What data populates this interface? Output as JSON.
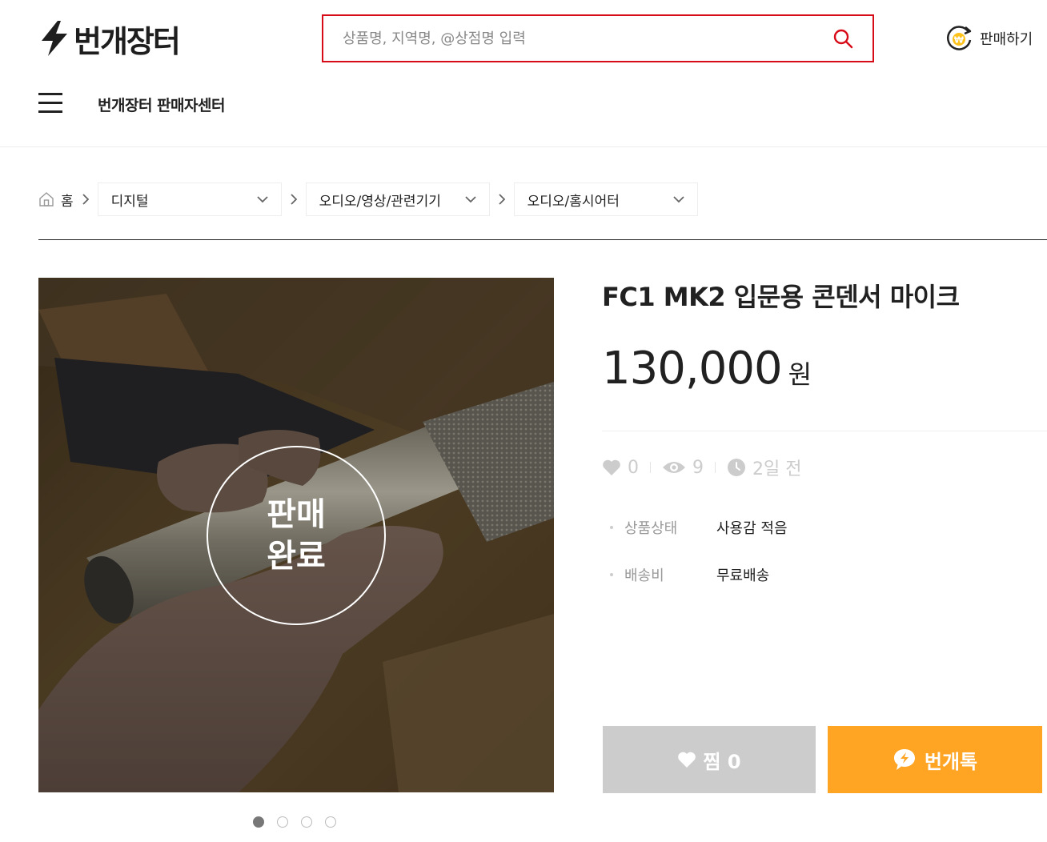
{
  "header": {
    "logo_text": "번개장터",
    "search_placeholder": "상품명, 지역명, @상점명 입력",
    "sell_label": "판매하기",
    "seller_center_label": "번개장터 판매자센터"
  },
  "breadcrumb": {
    "home_label": "홈",
    "categories": [
      "디지털",
      "오디오/영상/관련기기",
      "오디오/홈시어터"
    ]
  },
  "product": {
    "title": "FC1 MK2 입문용 콘덴서 마이크",
    "price": "130,000",
    "price_unit": "원",
    "sold_badge_line1": "판매",
    "sold_badge_line2": "완료",
    "image_count": 4,
    "active_image_index": 0,
    "stats": {
      "likes": "0",
      "views": "9",
      "posted": "2일 전"
    },
    "info": [
      {
        "label": "상품상태",
        "value": "사용감 적음"
      },
      {
        "label": "배송비",
        "value": "무료배송"
      }
    ]
  },
  "actions": {
    "favorite_label": "찜 0",
    "chat_label": "번개톡"
  },
  "colors": {
    "brand_red": "#d80c18",
    "chat_orange": "#ffa423",
    "disabled_gray": "#cccccc"
  }
}
